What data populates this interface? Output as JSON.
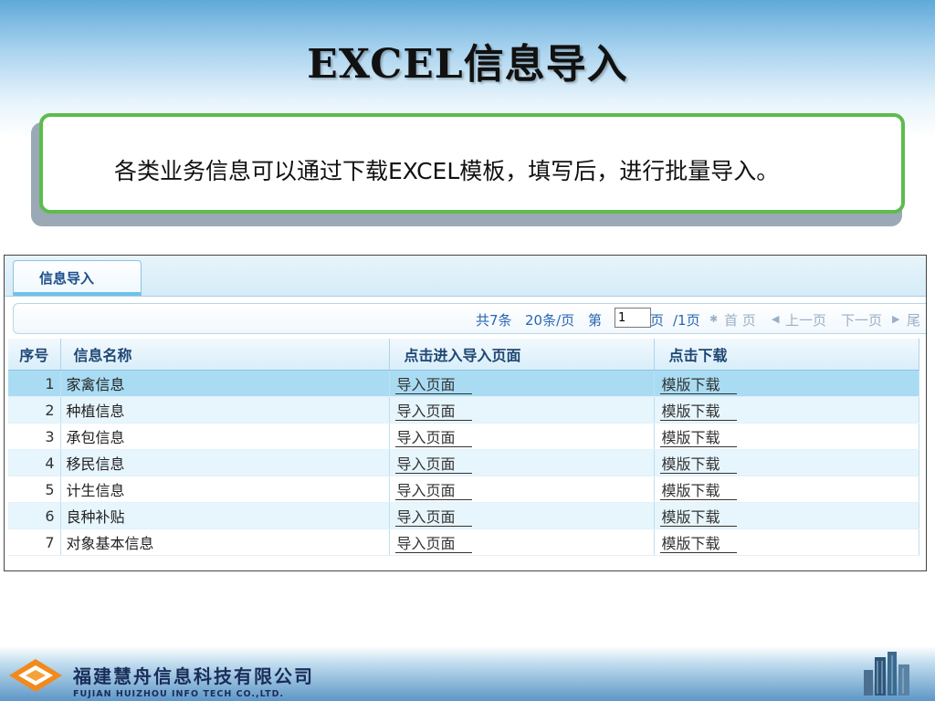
{
  "slide": {
    "title": "EXCEL信息导入",
    "description": "各类业务信息可以通过下载EXCEL模板，填写后，进行批量导入。"
  },
  "panel": {
    "tab_label": "信息导入",
    "pager": {
      "total": "共7条",
      "per_page": "20条/页",
      "page_prefix": "第",
      "page_value": "1",
      "page_suffix": "页",
      "page_count": "/1页",
      "first": "首 页",
      "prev": "上一页",
      "next": "下一页",
      "last": "尾"
    },
    "columns": [
      "序号",
      "信息名称",
      "点击进入导入页面",
      "点击下载"
    ],
    "rows": [
      {
        "no": "1",
        "name": "家禽信息",
        "import": "导入页面",
        "download": "模版下载"
      },
      {
        "no": "2",
        "name": "种植信息",
        "import": "导入页面",
        "download": "模版下载"
      },
      {
        "no": "3",
        "name": "承包信息",
        "import": "导入页面",
        "download": "模版下载"
      },
      {
        "no": "4",
        "name": "移民信息",
        "import": "导入页面",
        "download": "模版下载"
      },
      {
        "no": "5",
        "name": "计生信息",
        "import": "导入页面",
        "download": "模版下载"
      },
      {
        "no": "6",
        "name": "良种补贴",
        "import": "导入页面",
        "download": "模版下载"
      },
      {
        "no": "7",
        "name": "对象基本信息",
        "import": "导入页面",
        "download": "模版下载"
      }
    ]
  },
  "footer": {
    "company_cn": "福建慧舟信息科技有限公司",
    "company_en": "FUJIAN HUIZHOU INFO TECH CO.,LTD."
  },
  "colors": {
    "accent_green": "#5cbc4d",
    "header_blue": "#1e4673",
    "link_blue": "#2a66b4",
    "selected_row": "#a9dcf3"
  }
}
